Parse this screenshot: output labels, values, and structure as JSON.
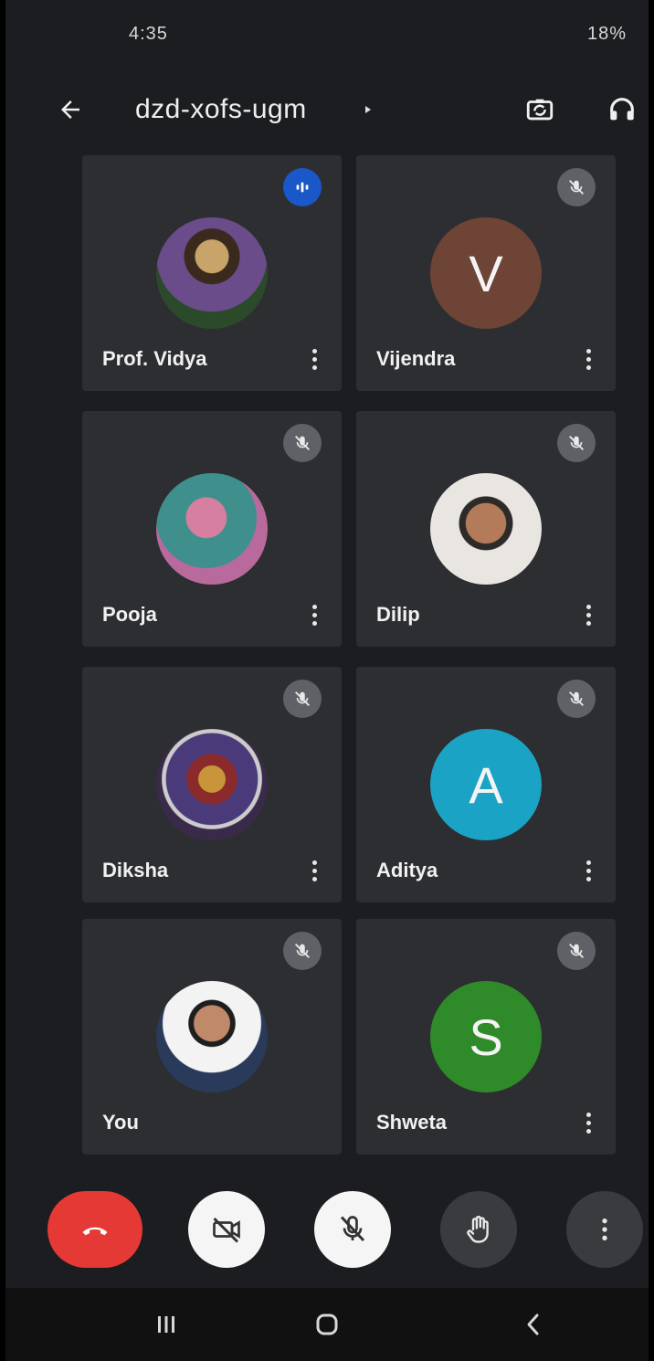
{
  "status_bar": {
    "time": "4:35",
    "right_text": "18%"
  },
  "header": {
    "meeting_code": "dzd-xofs-ugm"
  },
  "participants": [
    {
      "name": "Prof. Vidya",
      "avatar_type": "photo",
      "avatar_letter": "",
      "avatar_color": "#6a5a3a",
      "speaking": true
    },
    {
      "name": "Vijendra",
      "avatar_type": "letter",
      "avatar_letter": "V",
      "avatar_color": "#6d4436",
      "speaking": false
    },
    {
      "name": "Pooja",
      "avatar_type": "photo",
      "avatar_letter": "",
      "avatar_color": "#4a8b88",
      "speaking": false
    },
    {
      "name": "Dilip",
      "avatar_type": "photo",
      "avatar_letter": "",
      "avatar_color": "#e2dcd6",
      "speaking": false
    },
    {
      "name": "Diksha",
      "avatar_type": "photo",
      "avatar_letter": "",
      "avatar_color": "#5b3f6a",
      "speaking": false
    },
    {
      "name": "Aditya",
      "avatar_type": "letter",
      "avatar_letter": "A",
      "avatar_color": "#1aa3c4",
      "speaking": false
    },
    {
      "name": "You",
      "avatar_type": "photo",
      "avatar_letter": "",
      "avatar_color": "#f2f2f2",
      "speaking": false
    },
    {
      "name": "Shweta",
      "avatar_type": "letter",
      "avatar_letter": "S",
      "avatar_color": "#2f8a2a",
      "speaking": false
    }
  ],
  "colors": {
    "end_call": "#e53935",
    "speaking_indicator": "#1a57c9",
    "tile_background": "#2d2e31"
  },
  "icons": {
    "back": "arrow-left-icon",
    "switch_camera": "switch-camera-icon",
    "audio_output": "headphones-icon",
    "mic_off": "mic-off-icon",
    "more": "more-vert-icon",
    "end_call": "call-end-icon",
    "camera_off": "videocam-off-icon",
    "raise_hand": "hand-icon",
    "nav_recents": "recents-icon",
    "nav_home": "home-icon",
    "nav_back": "nav-back-icon"
  }
}
